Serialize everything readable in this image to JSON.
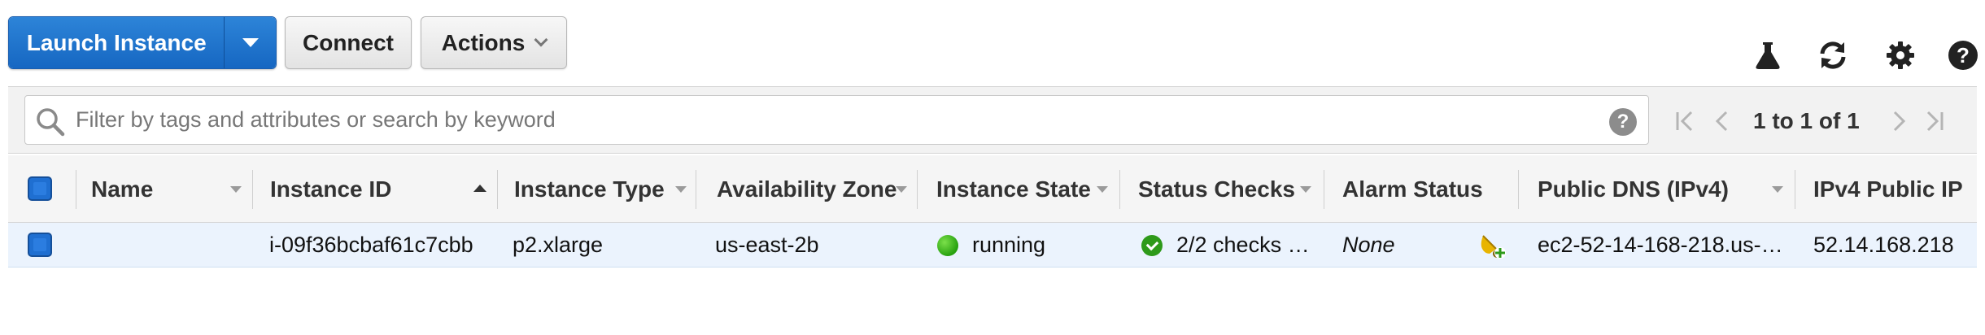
{
  "toolbar": {
    "launch_label": "Launch Instance",
    "connect_label": "Connect",
    "actions_label": "Actions",
    "icons": [
      "flask-icon",
      "refresh-icon",
      "gear-icon",
      "help-icon"
    ]
  },
  "filter": {
    "placeholder": "Filter by tags and attributes or search by keyword",
    "help_glyph": "?",
    "pagination": "1 to 1 of 1"
  },
  "table": {
    "columns": [
      {
        "label": "Name"
      },
      {
        "label": "Instance ID"
      },
      {
        "label": "Instance Type"
      },
      {
        "label": "Availability Zone"
      },
      {
        "label": "Instance State"
      },
      {
        "label": "Status Checks"
      },
      {
        "label": "Alarm Status"
      },
      {
        "label": "Public DNS (IPv4)"
      },
      {
        "label": "IPv4 Public IP"
      }
    ],
    "rows": [
      {
        "name": "",
        "instance_id": "i-09f36bcbaf61c7cbb",
        "instance_type": "p2.xlarge",
        "availability_zone": "us-east-2b",
        "instance_state": "running",
        "status_checks": "2/2 checks …",
        "alarm_status": "None",
        "public_dns": "ec2-52-14-168-218.us-…",
        "ipv4_public_ip": "52.14.168.218",
        "selected": true
      }
    ]
  },
  "colors": {
    "primary": "#1667c2",
    "running": "#27a10f",
    "selected_row": "#ebf3fd"
  }
}
